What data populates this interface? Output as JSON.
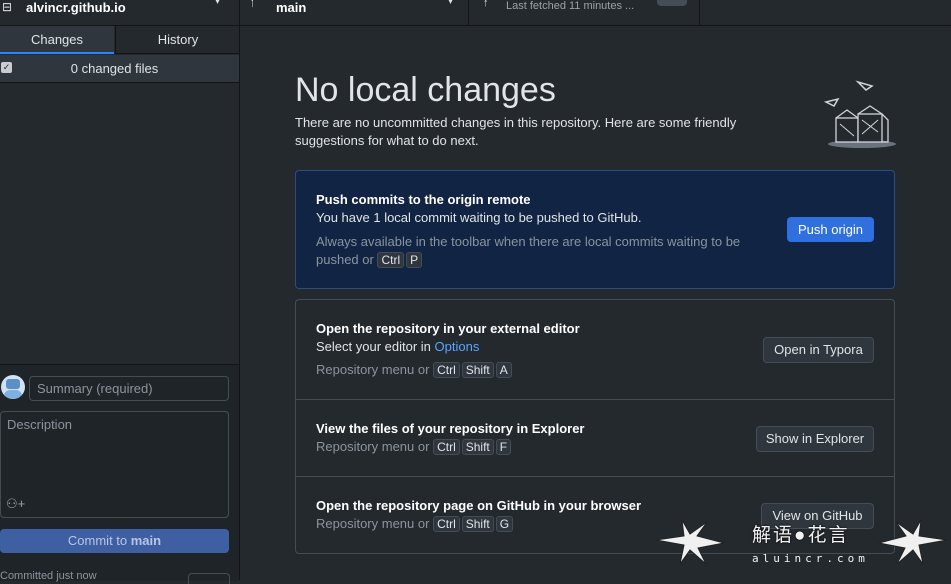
{
  "toolbar": {
    "repo_name": "alvincr.github.io",
    "branch_name": "main",
    "fetch_status": "Last fetched 11 minutes ..."
  },
  "sidebar": {
    "tabs": [
      {
        "label": "Changes"
      },
      {
        "label": "History"
      }
    ],
    "changed_files": "0 changed files",
    "summary_placeholder": "Summary (required)",
    "description_placeholder": "Description",
    "commit_label": "Commit to ",
    "commit_branch": "main",
    "committed_status": "Committed just now"
  },
  "main": {
    "title": "No local changes",
    "intro": "There are no uncommitted changes in this repository. Here are some friendly suggestions for what to do next.",
    "push": {
      "heading": "Push commits to the origin remote",
      "desc": "You have 1 local commit waiting to be pushed to GitHub.",
      "hint": "Always available in the toolbar when there are local commits waiting to be pushed or",
      "keys": [
        "Ctrl",
        "P"
      ],
      "button": "Push origin"
    },
    "editor": {
      "heading": "Open the repository in your external editor",
      "desc": "Select your editor in ",
      "link": "Options",
      "hint": "Repository menu or",
      "keys": [
        "Ctrl",
        "Shift",
        "A"
      ],
      "button": "Open in Typora"
    },
    "explorer": {
      "heading": "View the files of your repository in Explorer",
      "hint": "Repository menu or",
      "keys": [
        "Ctrl",
        "Shift",
        "F"
      ],
      "button": "Show in Explorer"
    },
    "github": {
      "heading": "Open the repository page on GitHub in your browser",
      "hint": "Repository menu or",
      "keys": [
        "Ctrl",
        "Shift",
        "G"
      ],
      "button": "View on GitHub"
    }
  },
  "watermark": {
    "cn": "解语●花言",
    "en": "aluincr.com"
  },
  "colors": {
    "accent": "#2188ff",
    "link": "#58a6ff",
    "push_card_bg": "#112443"
  }
}
